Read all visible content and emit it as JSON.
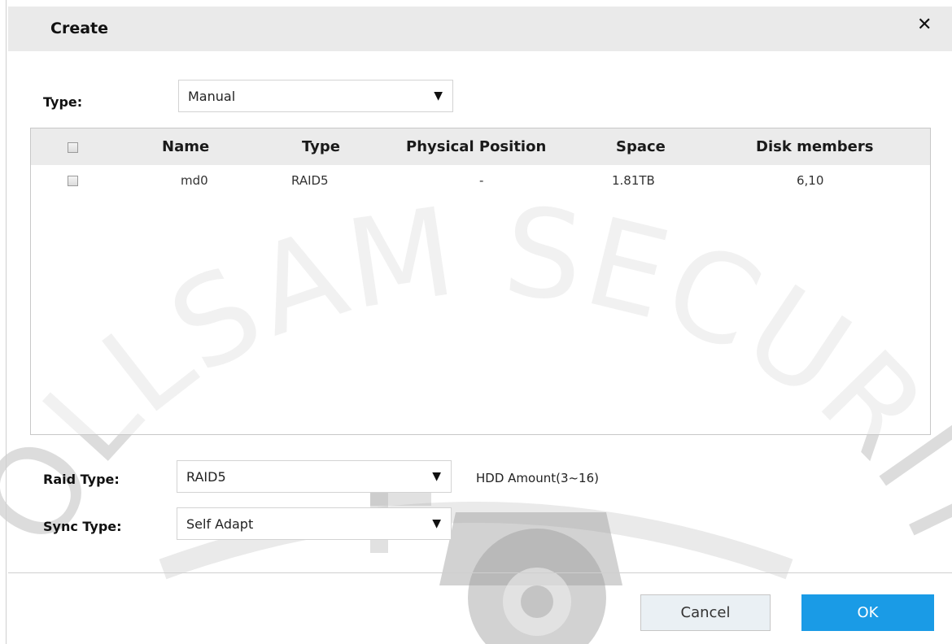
{
  "dialog": {
    "title": "Create",
    "close_symbol": "✕"
  },
  "type_field": {
    "label": "Type:",
    "value": "Manual",
    "arrow": "▼"
  },
  "table": {
    "columns": [
      "Name",
      "Type",
      "Physical Position",
      "Space",
      "Disk members"
    ],
    "rows": [
      {
        "name": "md0",
        "type": "RAID5",
        "physical_position": "-",
        "space": "1.81TB",
        "disk_members": "6,10"
      }
    ]
  },
  "raid_type": {
    "label": "Raid Type:",
    "value": "RAID5",
    "arrow": "▼",
    "hint": "HDD Amount(3~16)"
  },
  "sync_type": {
    "label": "Sync Type:",
    "value": "Self Adapt",
    "arrow": "▼"
  },
  "buttons": {
    "cancel": "Cancel",
    "ok": "OK"
  },
  "watermark": {
    "text": "COLLSAM SECURITY"
  }
}
